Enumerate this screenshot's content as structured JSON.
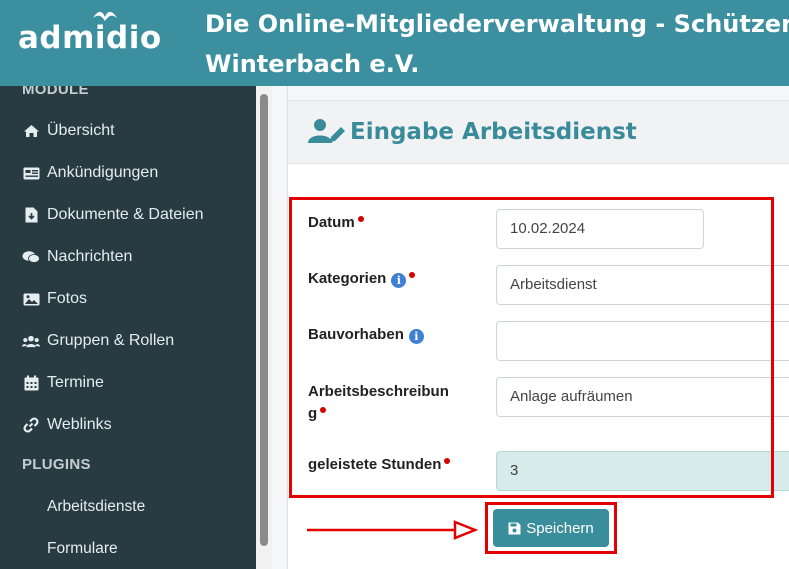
{
  "header": {
    "logo_text": "admidio",
    "title_line1": "Die Online-Mitgliederverwaltung - Schützen",
    "title_line2": "Winterbach e.V."
  },
  "sidebar": {
    "section_module": "MODULE",
    "items": [
      {
        "label": "Übersicht",
        "icon": "home-icon"
      },
      {
        "label": "Ankündigungen",
        "icon": "newspaper-icon"
      },
      {
        "label": "Dokumente & Dateien",
        "icon": "file-download-icon"
      },
      {
        "label": "Nachrichten",
        "icon": "comments-icon"
      },
      {
        "label": "Fotos",
        "icon": "image-icon"
      },
      {
        "label": "Gruppen & Rollen",
        "icon": "users-icon"
      },
      {
        "label": "Termine",
        "icon": "calendar-icon"
      },
      {
        "label": "Weblinks",
        "icon": "link-icon"
      }
    ],
    "section_plugins": "PLUGINS",
    "plugins": [
      {
        "label": "Arbeitsdienste"
      },
      {
        "label": "Formulare"
      }
    ]
  },
  "main": {
    "title": "Eingabe Arbeitsdienst",
    "title_icon": "user-edit-icon",
    "fields": {
      "datum": {
        "label": "Datum",
        "value": "10.02.2024",
        "required": true
      },
      "kategorien": {
        "label": "Kategorien",
        "value": "Arbeitsdienst",
        "required": true,
        "info": "i"
      },
      "bauvorhaben": {
        "label": "Bauvorhaben",
        "value": "",
        "info": "i"
      },
      "beschreibung": {
        "label_line1": "Arbeitsbeschreibun",
        "label_line2": "g",
        "value": "Anlage aufräumen",
        "required": true
      },
      "stunden": {
        "label": "geleistete Stunden",
        "value": "3",
        "required": true
      }
    },
    "save_label": "Speichern"
  },
  "colors": {
    "header_bg": "#3c8f9f",
    "sidebar_bg": "#283b43",
    "accent": "#3a8e9c",
    "required_dot": "#d40000",
    "annotation_red": "#e30000"
  }
}
